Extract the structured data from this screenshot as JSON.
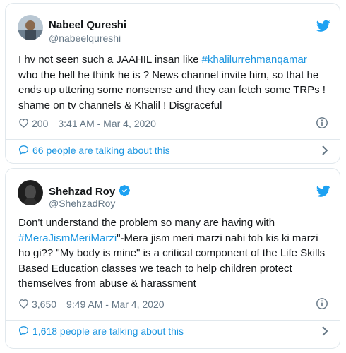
{
  "tweets": [
    {
      "name": "Nabeel Qureshi",
      "handle": "@nabeelqureshi",
      "verified": false,
      "text_before": "I hv not seen such a JAAHIL insan like ",
      "hashtag": "#khalilurrehmanqamar",
      "text_after": " who the hell he think he is ? News channel invite him, so that he ends up uttering some nonsense and they can fetch some TRPs ! shame on tv channels & Khalil ! Disgraceful",
      "likes": "200",
      "timestamp": "3:41 AM - Mar 4, 2020",
      "talking": "66 people are talking about this"
    },
    {
      "name": "Shehzad Roy",
      "handle": "@ShehzadRoy",
      "verified": true,
      "text_before": "Don't understand the problem so many are having with ",
      "hashtag": "#MeraJismMeriMarzi",
      "text_after": "\"-Mera jism meri marzi nahi toh kis ki marzi ho gi?? \"My body is mine\" is a critical component of the Life Skills Based Education classes we teach to help children protect themselves from abuse & harassment",
      "likes": "3,650",
      "timestamp": "9:49 AM - Mar 4, 2020",
      "talking": "1,618 people are talking about this"
    }
  ],
  "icons": {
    "brand": "twitter-bird-icon",
    "like": "heart-icon",
    "info": "info-icon",
    "reply": "speech-bubble-icon",
    "chevron": "chevron-right-icon",
    "verified": "verified-badge-icon"
  },
  "colors": {
    "link": "#1b95e0",
    "twitter_blue": "#1da1f2",
    "muted": "#657786",
    "border": "#e1e8ed",
    "text": "#14171a"
  }
}
